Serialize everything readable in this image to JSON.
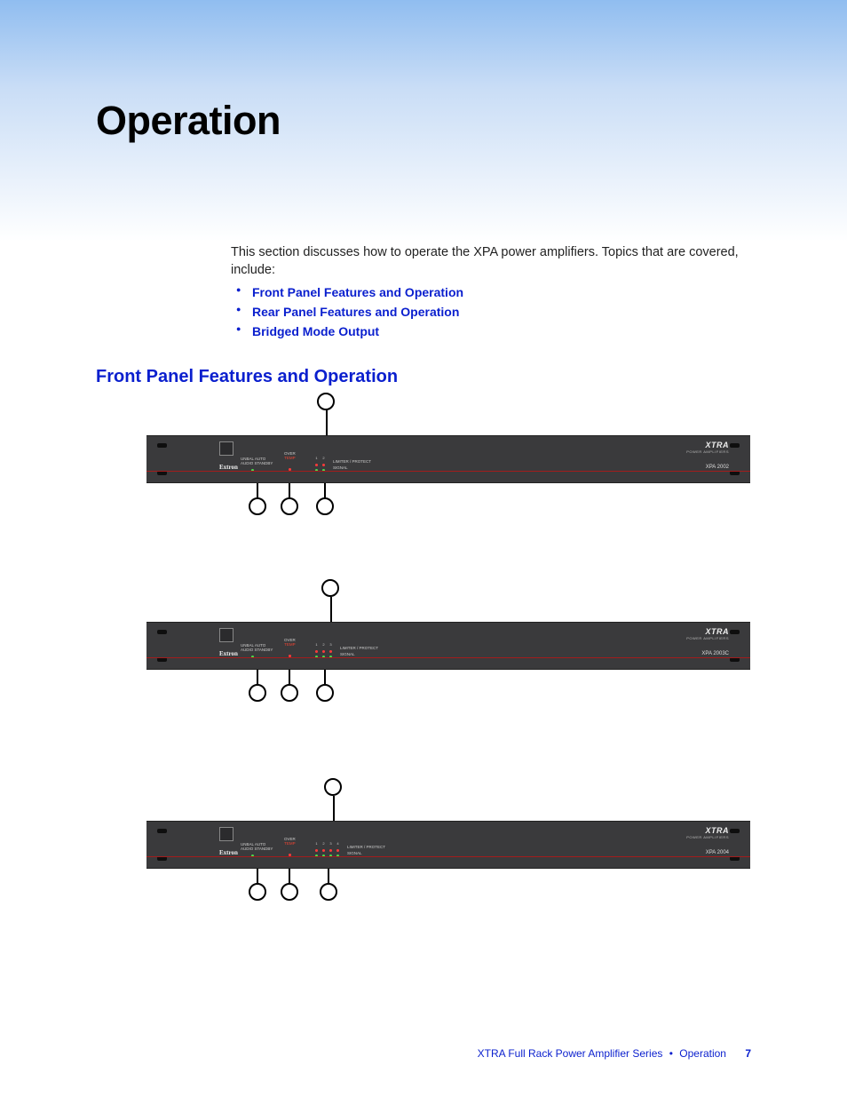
{
  "title": "Operation",
  "intro": "This section discusses how to operate the XPA power amplifiers. Topics that are covered, include:",
  "toc": [
    "Front Panel Features and Operation",
    "Rear Panel Features and Operation",
    "Bridged Mode Output"
  ],
  "section_heading": "Front Panel Features and Operation",
  "panel_common": {
    "brand": "XTRA",
    "brand_sub": "POWER AMPLIFIERS",
    "extron": "Extron",
    "auto_label": "UNBAL AUTO\nAUDIO STANDBY",
    "over_label_1": "OVER",
    "over_label_2": "TEMP",
    "limiter": "LIMITER / PROTECT",
    "signal": "SIGNAL"
  },
  "panels": [
    {
      "model": "XPA 2002",
      "channels": [
        "1",
        "2"
      ]
    },
    {
      "model": "XPA 2003C",
      "channels": [
        "1",
        "2",
        "3"
      ]
    },
    {
      "model": "XPA 2004",
      "channels": [
        "1",
        "2",
        "3",
        "4"
      ]
    }
  ],
  "footer": {
    "product": "XTRA Full Rack Power Amplifier Series",
    "section": "Operation",
    "page": "7"
  }
}
